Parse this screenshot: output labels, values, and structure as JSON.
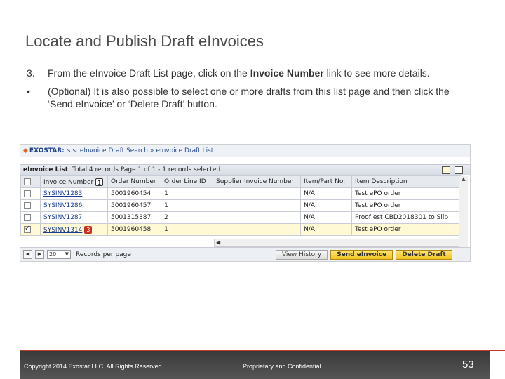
{
  "slide": {
    "title": "Locate and Publish Draft eInvoices",
    "bullets": [
      {
        "marker": "3.",
        "pre": "From the eInvoice Draft List page, click on the ",
        "bold": "Invoice Number",
        "post": " link to see more details."
      },
      {
        "marker": "•",
        "pre": "(Optional) It is also possible to select one or more drafts from this list page and then click the ‘Send eInvoice’ or ‘Delete Draft’ button.",
        "bold": "",
        "post": ""
      }
    ]
  },
  "screenshot": {
    "breadcrumb": {
      "logo": "EXOSTAR:",
      "items": [
        "s.s.",
        "eInvoice Draft Search",
        "»",
        "eInvoice Draft List"
      ]
    },
    "list_header": {
      "label": "eInvoice List",
      "summary": "Total 4 records Page 1 of 1 - 1 records selected"
    },
    "columns": [
      "",
      "Invoice Number",
      "Order Number",
      "Order Line ID",
      "Supplier Invoice Number",
      "Item/Part No.",
      "Item Description"
    ],
    "rows": [
      {
        "checked": false,
        "invoice": "SYSINV1283",
        "order": "5001960454",
        "line": "1",
        "supplier_inv": "",
        "part": "N/A",
        "desc": "Test ePO order"
      },
      {
        "checked": false,
        "invoice": "SYSINV1286",
        "order": "5001960457",
        "line": "1",
        "supplier_inv": "",
        "part": "N/A",
        "desc": "Test ePO order"
      },
      {
        "checked": false,
        "invoice": "SYSINV1287",
        "order": "5001315387",
        "line": "2",
        "supplier_inv": "",
        "part": "N/A",
        "desc": "Proof   est CBD2018301 to Slip"
      },
      {
        "checked": true,
        "invoice": "SYSINV1314",
        "order": "5001960458",
        "line": "1",
        "supplier_inv": "",
        "part": "N/A",
        "desc": "Test ePO order"
      }
    ],
    "annotations": {
      "one": "1",
      "three": "3"
    },
    "pager": {
      "page_size": "20",
      "records_label": "Records per page",
      "view_history": "View History",
      "send": "Send eInvoice",
      "delete": "Delete Draft"
    }
  },
  "footer": {
    "copyright": "Copyright 2014 Exostar LLC. All Rights Reserved.",
    "proprietary": "Proprietary and Confidential",
    "page_number": "53"
  }
}
